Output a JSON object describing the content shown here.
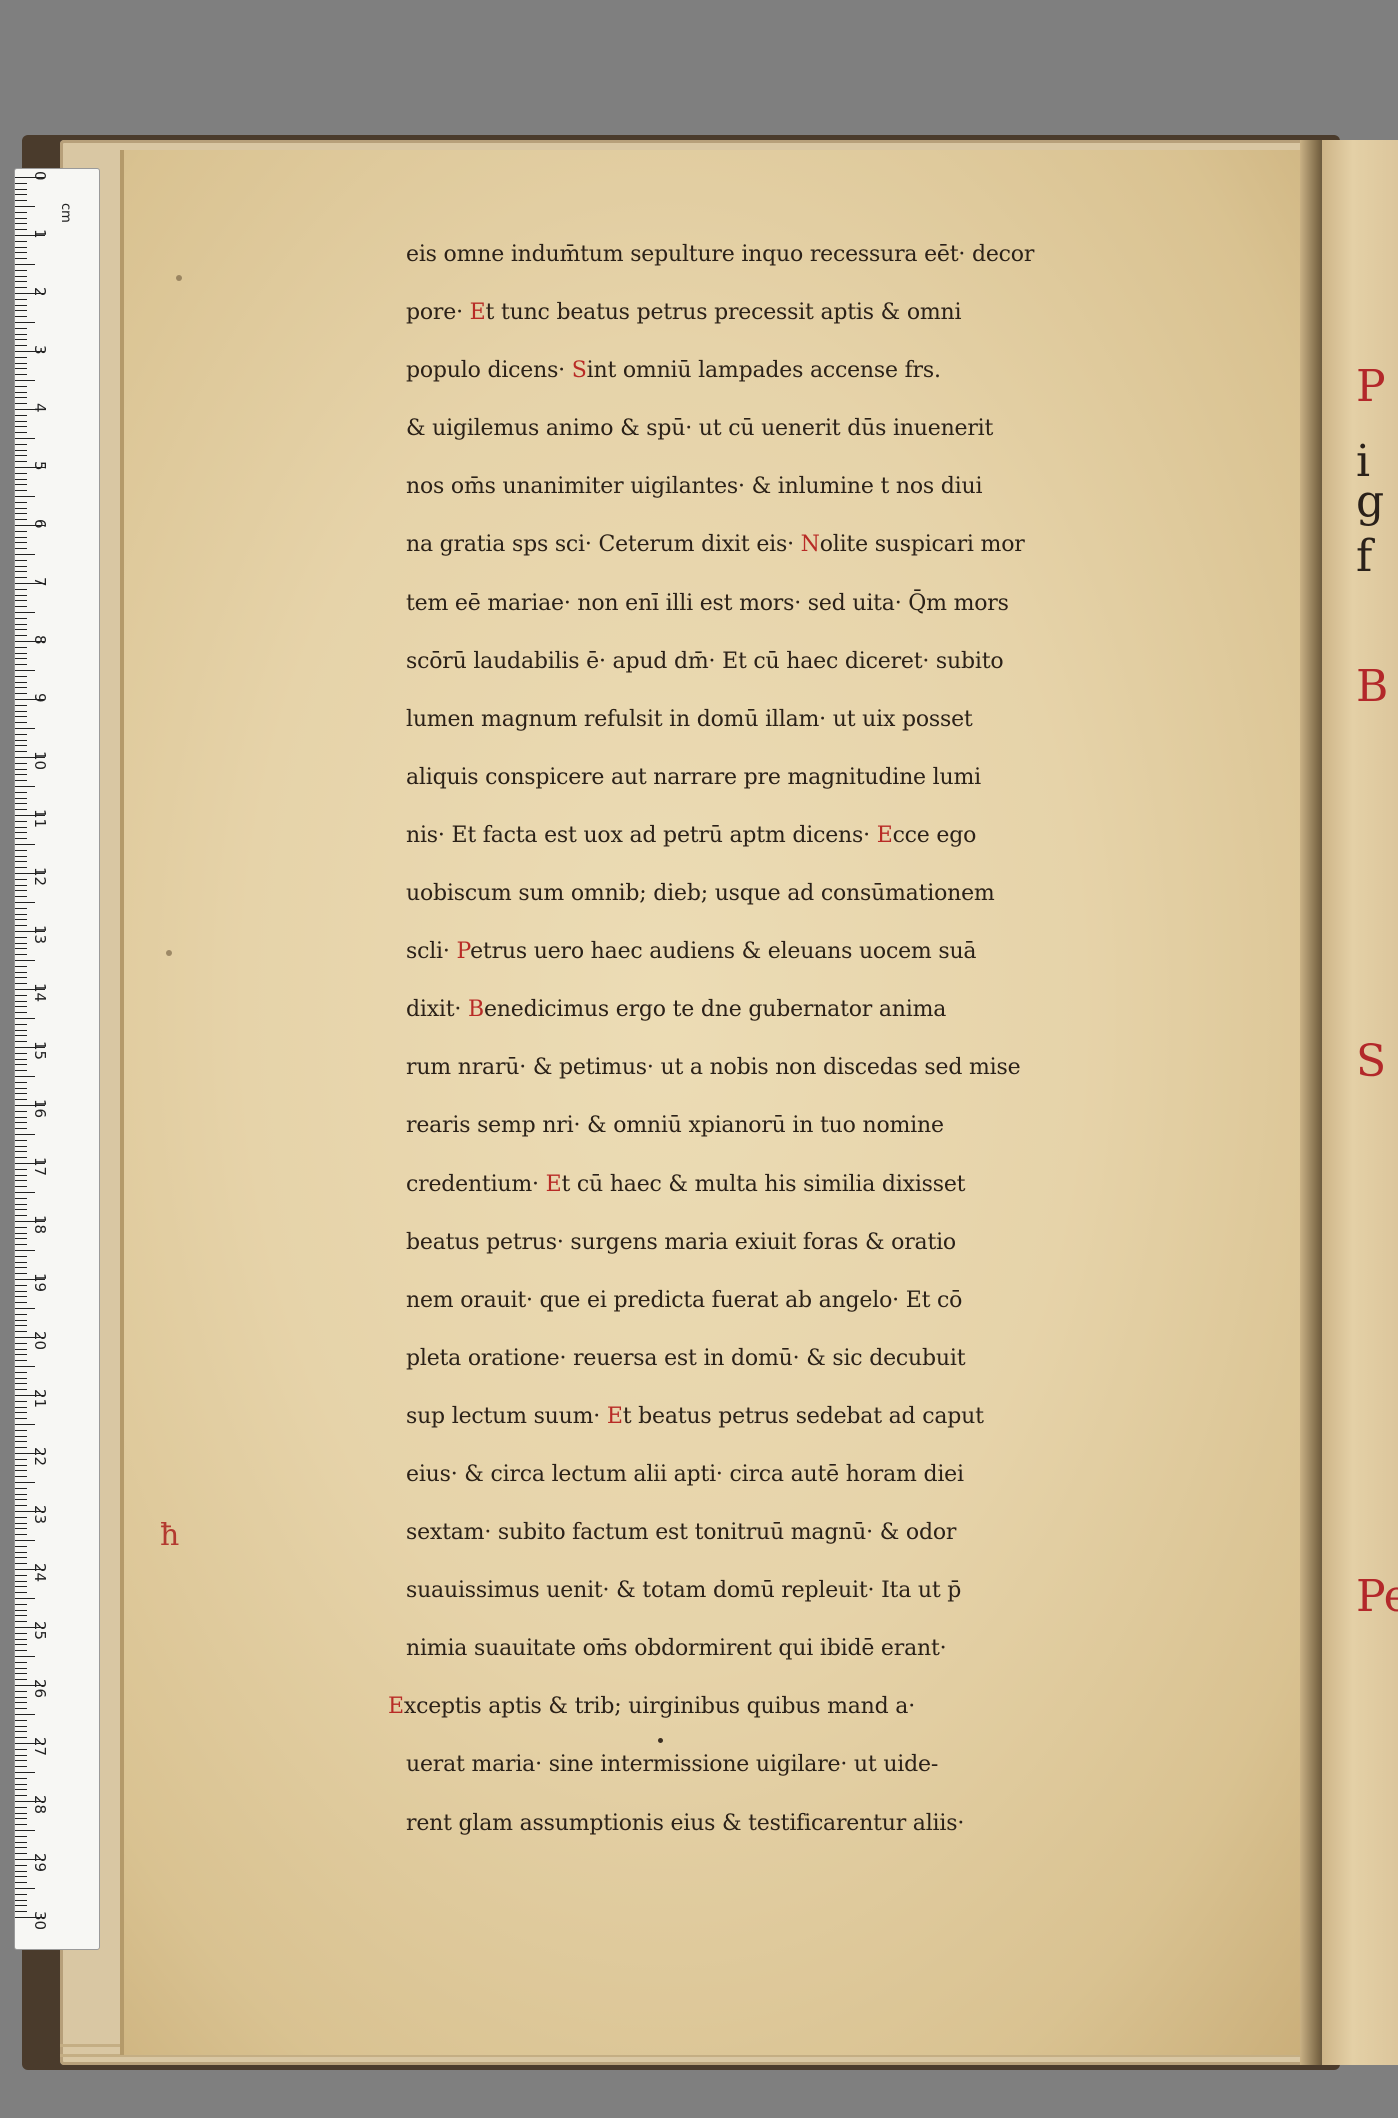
{
  "ruler": {
    "unit": "cm",
    "numbers": [
      "0",
      "1",
      "2",
      "3",
      "4",
      "5",
      "6",
      "7",
      "8",
      "9",
      "10",
      "11",
      "12",
      "13",
      "14",
      "15",
      "16",
      "17",
      "18",
      "19",
      "20",
      "21",
      "22",
      "23",
      "24",
      "25",
      "26",
      "27",
      "28",
      "29",
      "30"
    ]
  },
  "manuscript": {
    "lines": [
      {
        "ini": "",
        "text": "eis omne indum̄tum sepulture inquo recessura eēt· decor"
      },
      {
        "ini": "",
        "text": "pore· ",
        "ini2": "E",
        "text2": "t tunc beatus petrus precessit aptis & omni"
      },
      {
        "ini": "",
        "text": "populo dicens· ",
        "ini2": "S",
        "text2": "int omniū lampades accense frs."
      },
      {
        "ini": "",
        "text": "& uigilemus animo & spū· ut cū uenerit dūs inuenerit"
      },
      {
        "ini": "",
        "text": "nos om̄s unanimiter uigilantes· & inlumine t nos diui"
      },
      {
        "ini": "",
        "text": "na gratia sps sci· Ceterum dixit eis· ",
        "ini2": "N",
        "text2": "olite suspicari mor"
      },
      {
        "ini": "",
        "text": "tem eē mariae· non enī illi est mors· sed uita· Q̄m mors"
      },
      {
        "ini": "",
        "text": "scōrū laudabilis ē· apud dm̄· Et cū haec diceret· subito"
      },
      {
        "ini": "",
        "text": "lumen magnum refulsit in domū illam· ut uix posset"
      },
      {
        "ini": "",
        "text": "aliquis conspicere aut narrare pre magnitudine lumi"
      },
      {
        "ini": "",
        "text": "nis· Et facta est uox ad petrū aptm dicens· ",
        "ini2": "E",
        "text2": "cce ego"
      },
      {
        "ini": "",
        "text": "uobiscum sum omnib; dieb; usque ad consūmationem"
      },
      {
        "ini": "",
        "text": "scli· ",
        "ini2": "P",
        "text2": "etrus uero haec audiens & eleuans uocem suā"
      },
      {
        "ini": "",
        "text": "dixit· ",
        "ini2": "B",
        "text2": "enedicimus ergo te dne gubernator anima"
      },
      {
        "ini": "",
        "text": "rum nrarū· & petimus· ut a nobis non discedas sed mise"
      },
      {
        "ini": "",
        "text": "rearis semp nri· & omniū xpianorū in tuo nomine"
      },
      {
        "ini": "",
        "text": "credentium· ",
        "ini2": "E",
        "text2": "t cū haec & multa his similia dixisset"
      },
      {
        "ini": "",
        "text": "beatus petrus· surgens maria exiuit foras & oratio"
      },
      {
        "ini": "",
        "text": "nem orauit· que ei predicta fuerat ab angelo· Et cō"
      },
      {
        "ini": "",
        "text": "pleta oratione· reuersa est in domū· & sic decubuit"
      },
      {
        "ini": "",
        "text": "sup lectum suum· ",
        "ini2": "E",
        "text2": "t beatus petrus sedebat ad caput"
      },
      {
        "ini": "",
        "text": "eius· & circa lectum alii apti· circa autē horam diei"
      },
      {
        "ini": "",
        "text": "sextam· subito factum est tonitruū magnū· & odor"
      },
      {
        "ini": "",
        "text": "suauissimus uenit· & totam domū repleuit· Ita ut p̄"
      },
      {
        "ini": "",
        "text": "nimia suauitate om̄s obdormirent qui ibidē erant·"
      },
      {
        "ini": "E",
        "text": "xceptis aptis & trib; uirginibus quibus mand a·"
      },
      {
        "ini": "",
        "text": "uerat maria· sine intermissione uigilare· ut uide-"
      },
      {
        "ini": "",
        "text": "rent glam assumptionis eius & testificarentur aliis·"
      }
    ],
    "margin_mark": "ħ"
  },
  "facing_page": {
    "fragments": [
      {
        "text": "P",
        "red": true
      },
      {
        "text": "i",
        "red": false
      },
      {
        "text": "g",
        "red": false
      },
      {
        "text": "f",
        "red": false
      },
      {
        "text": "B",
        "red": true
      },
      {
        "text": "S",
        "red": true
      },
      {
        "text": "Pe",
        "red": true
      }
    ]
  },
  "colors": {
    "ink": "#2b2118",
    "rubric": "#b82b26",
    "parchment": "#e6d3a9"
  }
}
